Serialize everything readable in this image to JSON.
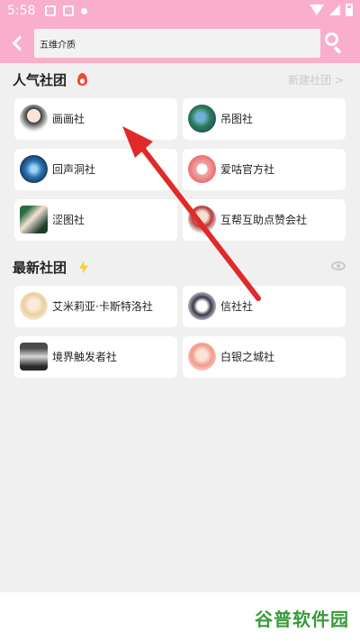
{
  "status_bar": {
    "time": "5:58"
  },
  "search": {
    "value": "五维介质"
  },
  "popular": {
    "title": "人气社团",
    "new_club_link": "新建社团 >",
    "clubs": [
      {
        "label": "画画社"
      },
      {
        "label": "吊图社"
      },
      {
        "label": "回声洞社"
      },
      {
        "label": "爱咕官方社"
      },
      {
        "label": "涩图社"
      },
      {
        "label": "互帮互助点赞会社"
      }
    ]
  },
  "newest": {
    "title": "最新社团",
    "clubs": [
      {
        "label": "艾米莉亚·卡斯特洛社"
      },
      {
        "label": "信社社"
      },
      {
        "label": "境界触发者社"
      },
      {
        "label": "白银之城社"
      }
    ]
  },
  "watermark": "谷普软件园",
  "colors": {
    "header": "#f9aecb",
    "background": "#f0f0f0",
    "arrow": "#e02a2a",
    "fire": "#ef4a2d",
    "bolt": "#f5d130"
  }
}
